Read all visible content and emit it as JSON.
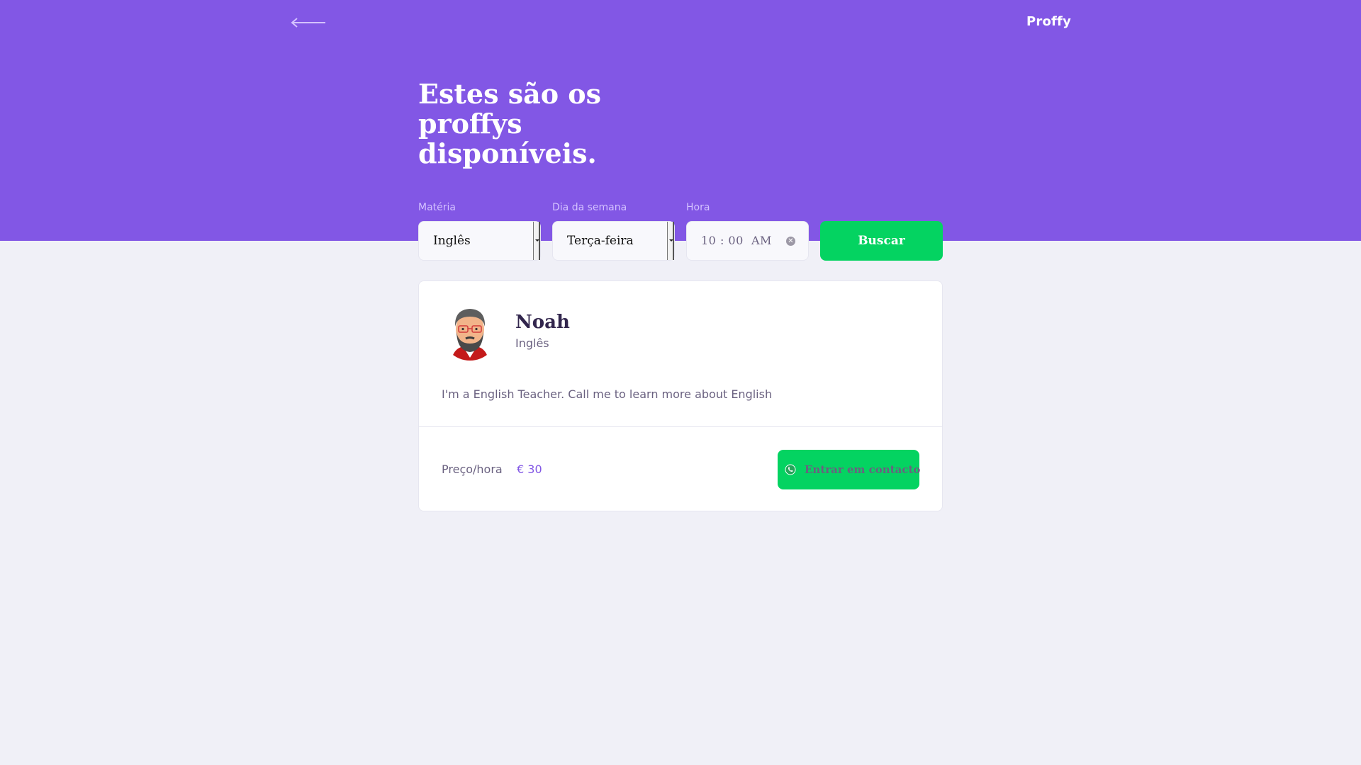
{
  "header": {
    "logo": "Proffy",
    "title": "Estes são os proffys disponíveis."
  },
  "filters": {
    "subject": {
      "label": "Matéria",
      "value": "Inglês"
    },
    "weekday": {
      "label": "Dia da semana",
      "value": "Terça-feira"
    },
    "time": {
      "label": "Hora",
      "value": "10 : 00  AM"
    },
    "search_label": "Buscar"
  },
  "teacher": {
    "name": "Noah",
    "subject": "Inglês",
    "bio": "I'm a English Teacher. Call me to learn more about English",
    "price_label": "Preço/hora",
    "price_value": "€ 30",
    "contact_label": "Entrar em contacto"
  },
  "colors": {
    "primary": "#8257e5",
    "secondary": "#04d361",
    "background": "#f0f0f7"
  },
  "icons": {
    "back": "arrow-left-icon",
    "clear": "clear-icon",
    "contact": "whatsapp-icon"
  }
}
